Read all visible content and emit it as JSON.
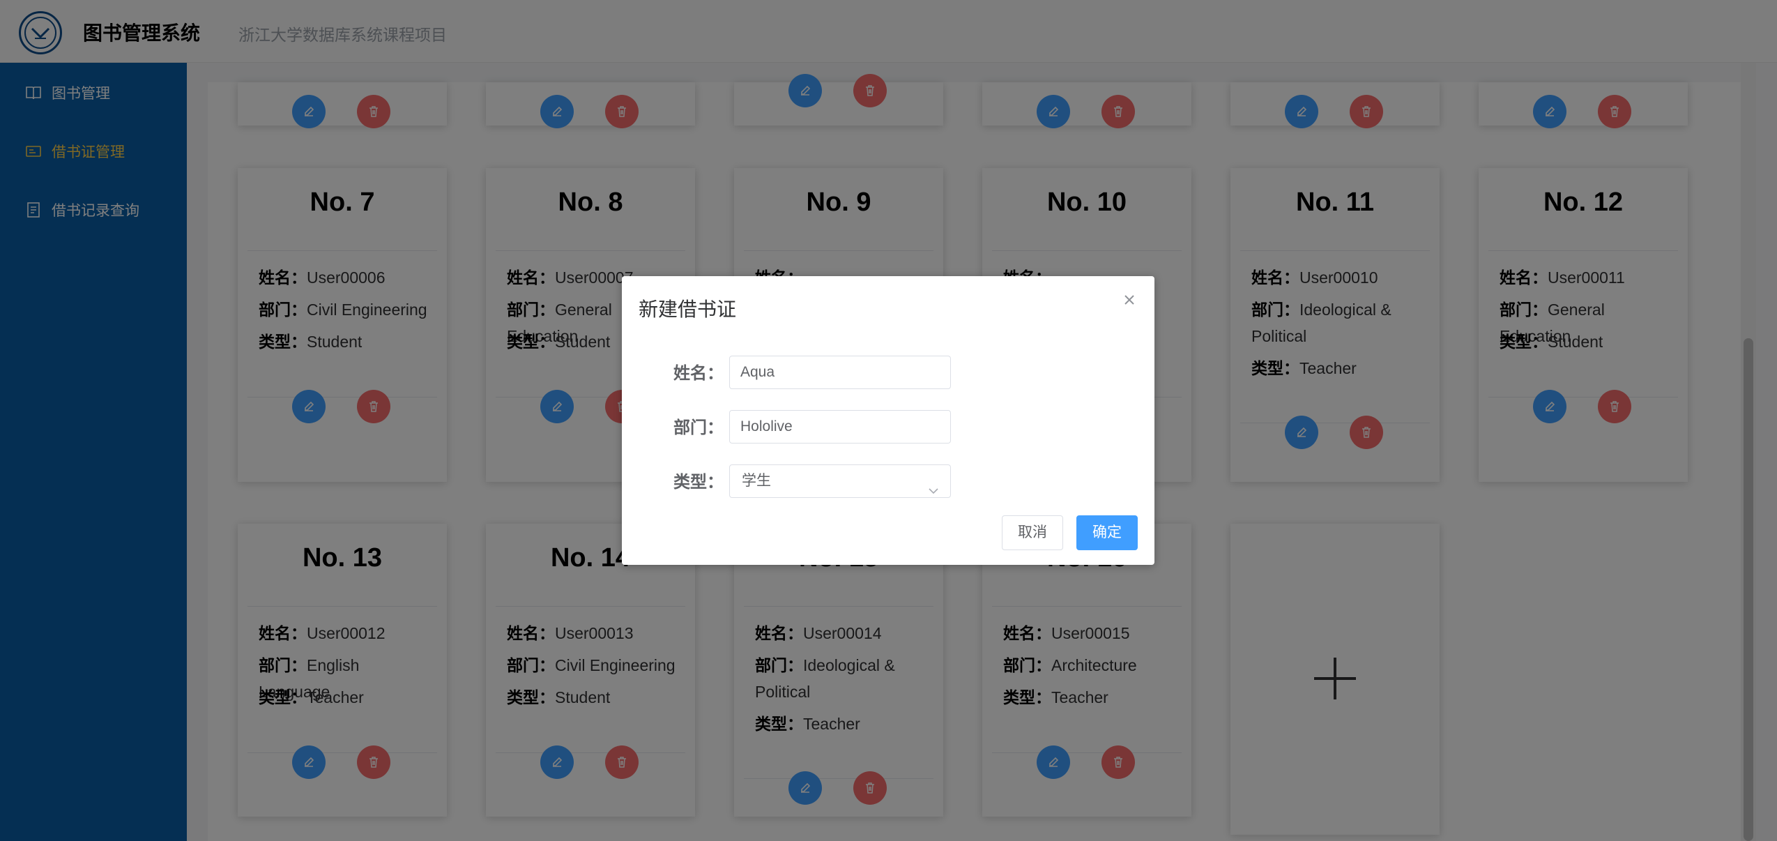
{
  "header": {
    "title": "图书管理系统",
    "subtitle": "浙江大学数据库系统课程项目"
  },
  "sidebar": {
    "items": [
      {
        "label": "图书管理",
        "icon": "book-icon",
        "active": false
      },
      {
        "label": "借书证管理",
        "icon": "card-icon",
        "active": true
      },
      {
        "label": "借书记录查询",
        "icon": "document-icon",
        "active": false
      }
    ]
  },
  "field_labels": {
    "name": "姓名：",
    "department": "部门：",
    "type": "类型："
  },
  "cards": [
    {
      "no": "No. 7",
      "name": "User00006",
      "department": "Civil Engineering",
      "type": "Student"
    },
    {
      "no": "No. 8",
      "name": "User00007",
      "department": "General Education",
      "type": "Student"
    },
    {
      "no": "No. 9",
      "name": "",
      "department": "",
      "type": ""
    },
    {
      "no": "No. 10",
      "name": "",
      "department": "",
      "type": ""
    },
    {
      "no": "No. 11",
      "name": "User00010",
      "department": "Ideological & Political",
      "type": "Teacher"
    },
    {
      "no": "No. 12",
      "name": "User00011",
      "department": "General Education",
      "type": "Student"
    },
    {
      "no": "No. 13",
      "name": "User00012",
      "department": "English Language",
      "type": "Teacher"
    },
    {
      "no": "No. 14",
      "name": "User00013",
      "department": "Civil Engineering",
      "type": "Student"
    },
    {
      "no": "No. 15",
      "name": "User00014",
      "department": "Ideological & Political",
      "type": "Teacher"
    },
    {
      "no": "No. 16",
      "name": "User00015",
      "department": "Architecture",
      "type": "Teacher"
    }
  ],
  "dialog": {
    "title": "新建借书证",
    "name_label": "姓名：",
    "name_value": "Aqua",
    "department_label": "部门：",
    "department_value": "Hololive",
    "type_label": "类型：",
    "type_value": "学生",
    "cancel_label": "取消",
    "confirm_label": "确定"
  },
  "colors": {
    "sidebar": "#0a5fa6",
    "active_nav": "#ffd04b",
    "primary": "#409eff",
    "danger": "#f56c6c"
  }
}
